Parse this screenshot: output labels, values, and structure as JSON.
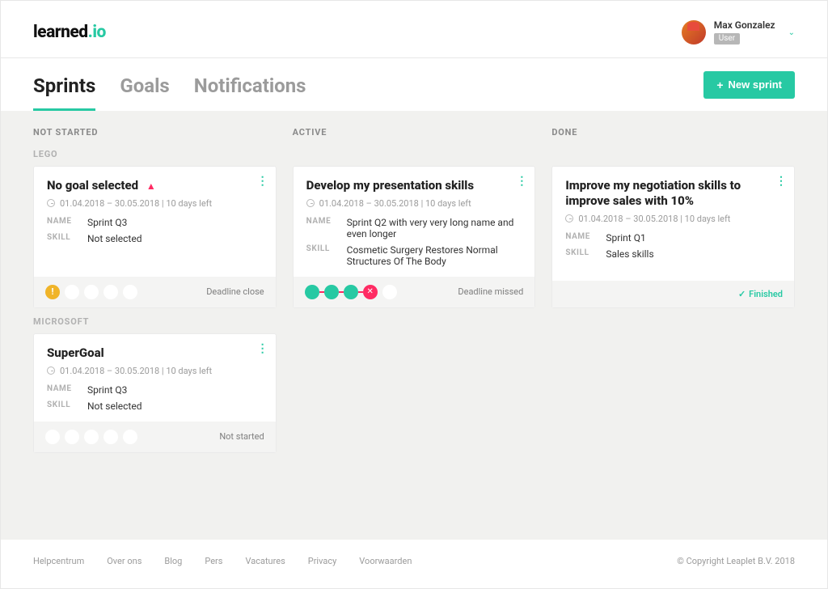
{
  "logo": {
    "main": "learned",
    "accent": ".io"
  },
  "user": {
    "name": "Max Gonzalez",
    "role": "User"
  },
  "tabs": {
    "sprints": "Sprints",
    "goals": "Goals",
    "notifications": "Notifications"
  },
  "newSprintBtn": "New sprint",
  "columns": {
    "notStarted": "NOT STARTED",
    "active": "ACTIVE",
    "done": "DONE"
  },
  "labels": {
    "name": "NAME",
    "skill": "SKILL"
  },
  "groups": {
    "lego": "LEGO",
    "microsoft": "MICROSOFT"
  },
  "cards": {
    "lego_notStarted": {
      "title": "No goal selected",
      "dateline": "01.04.2018 – 30.05.2018 | 10 days left",
      "name": "Sprint Q3",
      "skill": "Not selected",
      "status": "Deadline close"
    },
    "lego_active": {
      "title": "Develop my presentation skills",
      "dateline": "01.04.2018 – 30.05.2018 | 10 days left",
      "name": "Sprint Q2 with very very long name and even longer",
      "skill": "Cosmetic Surgery Restores Normal Structures Of The Body",
      "status": "Deadline missed"
    },
    "lego_done": {
      "title": "Improve my negotiation skills to improve sales with 10%",
      "dateline": "01.04.2018 – 30.05.2018 | 10 days left",
      "name": "Sprint Q1",
      "skill": "Sales skills",
      "status": "Finished"
    },
    "ms_notStarted": {
      "title": "SuperGoal",
      "dateline": "01.04.2018 – 30.05.2018 | 10 days left",
      "name": "Sprint Q3",
      "skill": "Not selected",
      "status": "Not started"
    }
  },
  "footer": {
    "links": [
      "Helpcentrum",
      "Over ons",
      "Blog",
      "Pers",
      "Vacatures",
      "Privacy",
      "Voorwaarden"
    ],
    "copyright": "© Copyright Leaplet B.V. 2018"
  }
}
